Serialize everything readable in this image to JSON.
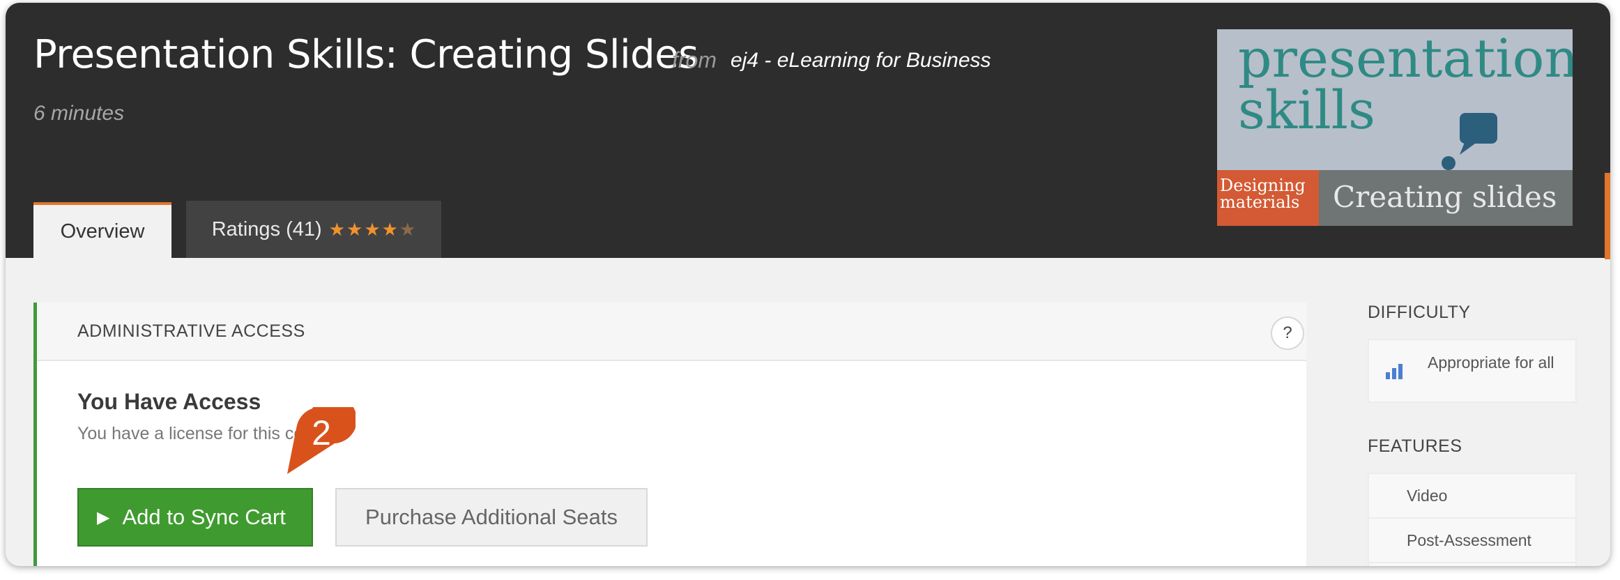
{
  "course": {
    "title": "Presentation Skills: Creating Slides",
    "from_label": "from",
    "provider": "ej4 - eLearning for Business",
    "duration": "6 minutes"
  },
  "tabs": [
    {
      "label": "Overview",
      "active": true
    },
    {
      "label": "Ratings (41)",
      "rating": 4,
      "rating_max": 5
    }
  ],
  "thumbnail": {
    "line1": "presentation",
    "line2": "skills",
    "left_caption": "Designing materials",
    "right_caption": "Creating slides"
  },
  "access": {
    "header": "ADMINISTRATIVE ACCESS",
    "help": "?",
    "title": "You Have Access",
    "description": "You have a license for this course",
    "sync_button": "Add to Sync Cart",
    "purchase_button": "Purchase Additional Seats"
  },
  "annotation": {
    "step": "2"
  },
  "sidebar": {
    "difficulty_heading": "DIFFICULTY",
    "difficulty_value": "Appropriate for all",
    "features_heading": "FEATURES",
    "features": [
      "Video",
      "Post-Assessment"
    ]
  },
  "colors": {
    "header_bg": "#2d2d2d",
    "accent_orange": "#e1762a",
    "success_green": "#3f9b2f",
    "badge": "#d9521c"
  }
}
